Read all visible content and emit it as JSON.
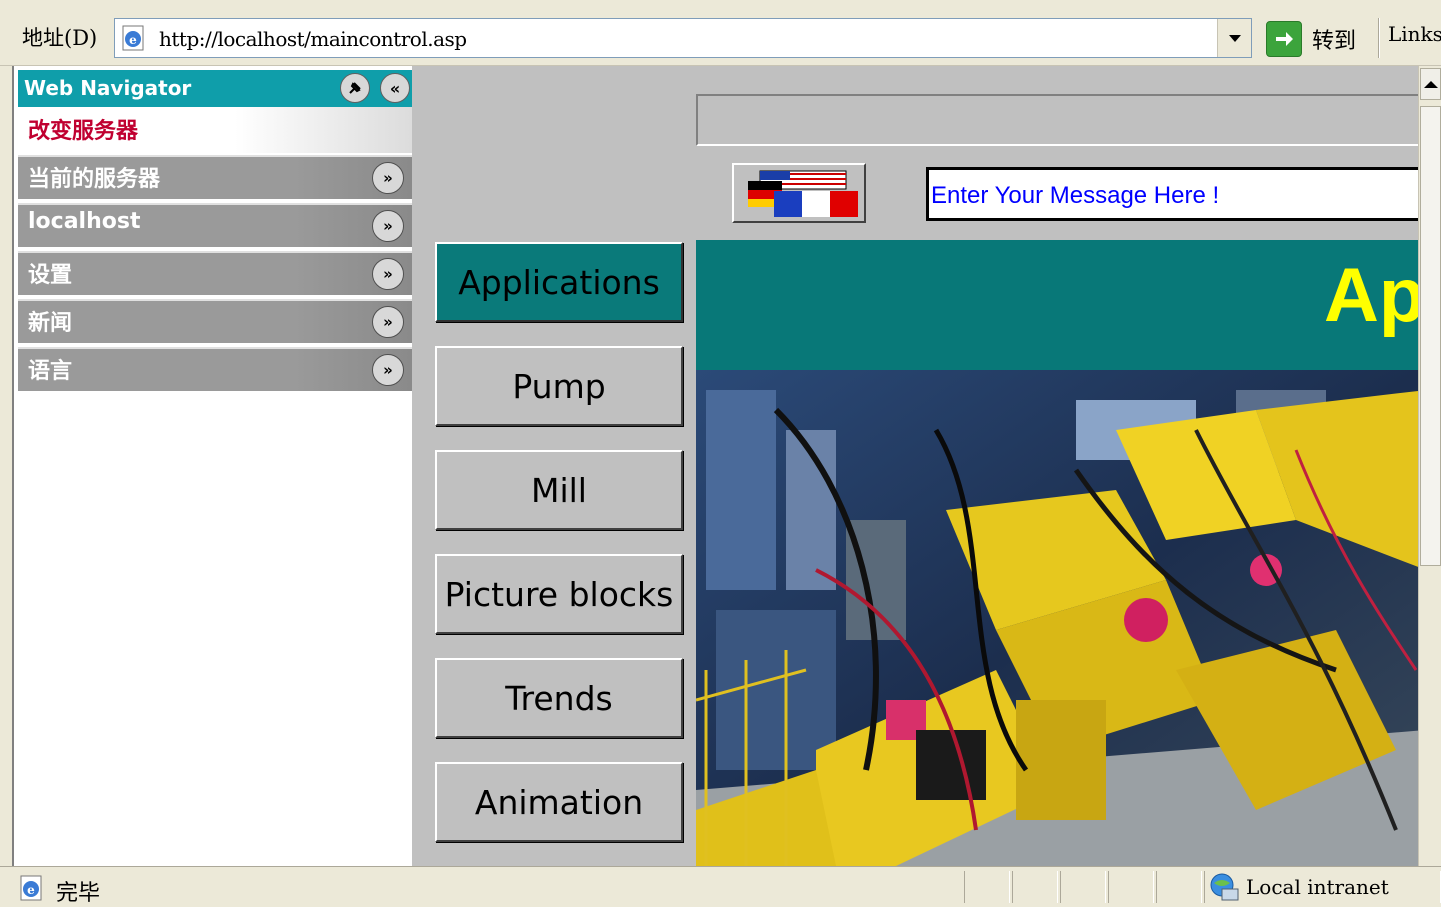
{
  "address_bar": {
    "label": "地址(D)",
    "url": "http://localhost/maincontrol.asp",
    "go_label": "转到",
    "links_label": "Links"
  },
  "sidebar": {
    "title": "Web Navigator",
    "change_server": "改变服务器",
    "sections": [
      {
        "label": "当前的服务器"
      },
      {
        "label": "localhost"
      },
      {
        "label": "设置"
      },
      {
        "label": "新闻"
      },
      {
        "label": "语言"
      }
    ],
    "pin_icon": "pin-icon",
    "collapse_icon": "double-chevron-left-icon",
    "expand_icon": "double-chevron-down-icon"
  },
  "app_buttons": [
    {
      "label": "Applications",
      "active": true
    },
    {
      "label": "Pump"
    },
    {
      "label": "Mill"
    },
    {
      "label": "Picture blocks"
    },
    {
      "label": "Trends"
    },
    {
      "label": "Animation"
    }
  ],
  "main": {
    "message_text": "Enter Your Message Here !",
    "banner_text": "Ap",
    "language_flags_icon": "language-flags-icon",
    "photo_subject": "industrial robot arms"
  },
  "status_bar": {
    "text": "完毕",
    "zone": "Local intranet"
  },
  "colors": {
    "nav_header": "#0f9eaa",
    "change_server_text": "#c00030",
    "banner_bg": "#087878",
    "banner_text": "#ffff00",
    "message_text": "#0000ff",
    "active_button": "#0a7a7a"
  }
}
